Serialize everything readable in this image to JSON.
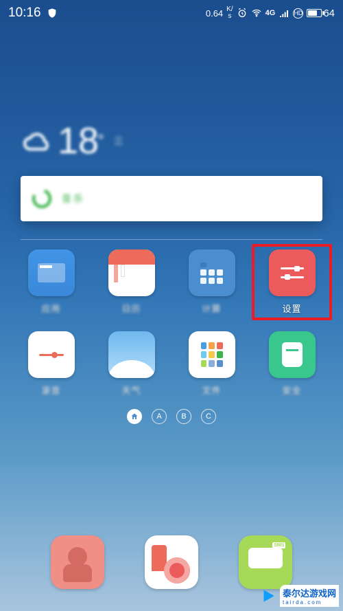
{
  "statusbar": {
    "time": "10:16",
    "netspeed_value": "0.64",
    "netspeed_unit_top": "K/",
    "netspeed_unit_bottom": "s",
    "network_label": "4G",
    "hd_label": "HD",
    "battery_percent": "64"
  },
  "weather": {
    "temp": "18",
    "degree": "°",
    "sub": "三"
  },
  "search": {
    "placeholder": "音乐"
  },
  "apps_row1": [
    {
      "name": "app-store",
      "label": "应用",
      "icon": "blue1"
    },
    {
      "name": "calendar",
      "label": "日历",
      "icon": "calendar"
    },
    {
      "name": "calculator",
      "label": "计算",
      "icon": "calculator"
    },
    {
      "name": "settings",
      "label": "设置",
      "icon": "settings",
      "highlight": true
    }
  ],
  "apps_row2": [
    {
      "name": "notes",
      "label": "录音",
      "icon": "note"
    },
    {
      "name": "weather",
      "label": "天气",
      "icon": "weather"
    },
    {
      "name": "files",
      "label": "文件",
      "icon": "files"
    },
    {
      "name": "security",
      "label": "安全",
      "icon": "security"
    }
  ],
  "indicator": {
    "pages": [
      "A",
      "B",
      "C"
    ]
  },
  "dock": [
    {
      "name": "contacts"
    },
    {
      "name": "camera"
    },
    {
      "name": "messages",
      "tag": "SMS"
    }
  ],
  "watermark": {
    "text": "泰尔达游戏网",
    "sub": "tairda.com"
  }
}
